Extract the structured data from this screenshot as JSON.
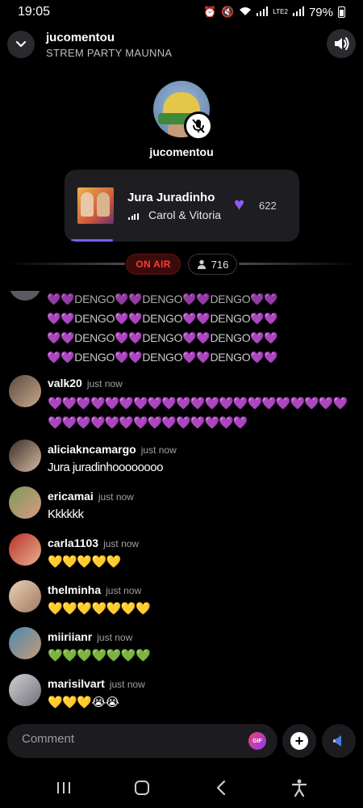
{
  "status_bar": {
    "time": "19:05",
    "battery": "79%",
    "network": "LTE2"
  },
  "header": {
    "host_name": "jucomentou",
    "room_title": "STREM PARTY MAUNNA"
  },
  "host": {
    "name": "jucomentou",
    "muted": true
  },
  "now_playing": {
    "title": "Jura Juradinho",
    "artist": "Carol & Vitoria",
    "likes": "622",
    "progress": 0.18
  },
  "status": {
    "on_air": "ON AIR",
    "listeners": "716"
  },
  "chat": {
    "partial_message": {
      "lines": [
        "💜💜DENGO💜💜DENGO💜💜DENGO💜💜",
        "💜💜DENGO💜💜DENGO💜💜DENGO💜💜",
        "💜💜DENGO💜💜DENGO💜💜DENGO💜💜",
        "💜💜DENGO💜💜DENGO💜💜DENGO💜💜"
      ]
    },
    "messages": [
      {
        "user": "valk20",
        "time": "just now",
        "text": "💜💜💜💜💜💜💜💜💜💜💜💜💜💜💜💜💜💜💜💜💜💜💜💜💜💜💜💜💜💜💜💜💜💜💜"
      },
      {
        "user": "aliciakncamargo",
        "time": "just now",
        "text": "Jura juradinhoooooooo"
      },
      {
        "user": "ericamai",
        "time": "just now",
        "text": "Kkkkkk"
      },
      {
        "user": "carla1103",
        "time": "just now",
        "text": "💛💛💛💛💛"
      },
      {
        "user": "thelminha",
        "time": "just now",
        "text": "💛💛💛💛💛💛💛"
      },
      {
        "user": "miiriianr",
        "time": "just now",
        "text": "💚💚💚💚💚💚💚"
      },
      {
        "user": "marisilvart",
        "time": "just now",
        "text": "💛💛💛😭😭"
      }
    ]
  },
  "composer": {
    "placeholder": "Comment",
    "gif_label": "GIF",
    "plus_label": "+"
  },
  "colors": {
    "accent": "#8b5cf6",
    "on_air": "#ff3b30",
    "background": "#000000"
  }
}
